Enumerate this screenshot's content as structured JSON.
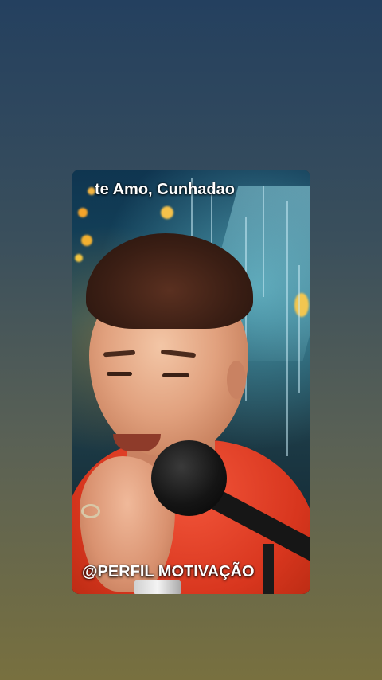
{
  "video": {
    "caption": "te Amo, Cunhadao",
    "watermark": "@PERFIL MOTIVAÇÃO"
  },
  "colors": {
    "background_top": "#24405f",
    "background_bottom": "#78703f",
    "shirt": "#e0401f",
    "text": "#ffffff"
  }
}
